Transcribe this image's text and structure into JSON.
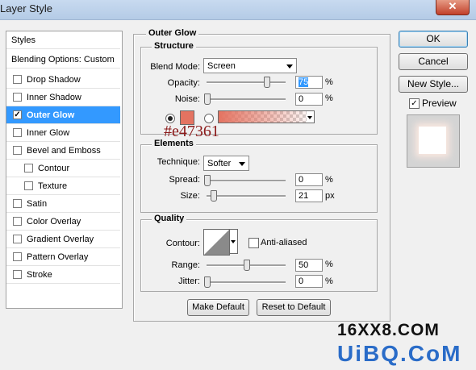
{
  "window": {
    "title": "Layer Style",
    "close_glyph": "✕"
  },
  "styles_list": {
    "header": "Styles",
    "blending": "Blending Options: Custom",
    "items": [
      {
        "label": "Drop Shadow",
        "checked": ""
      },
      {
        "label": "Inner Shadow",
        "checked": ""
      },
      {
        "label": "Outer Glow",
        "checked": "✓"
      },
      {
        "label": "Inner Glow",
        "checked": ""
      },
      {
        "label": "Bevel and Emboss",
        "checked": ""
      },
      {
        "label": "Contour",
        "checked": ""
      },
      {
        "label": "Texture",
        "checked": ""
      },
      {
        "label": "Satin",
        "checked": ""
      },
      {
        "label": "Color Overlay",
        "checked": ""
      },
      {
        "label": "Gradient Overlay",
        "checked": ""
      },
      {
        "label": "Pattern Overlay",
        "checked": ""
      },
      {
        "label": "Stroke",
        "checked": ""
      }
    ]
  },
  "outer_glow": {
    "title": "Outer Glow",
    "structure": {
      "title": "Structure",
      "blend_mode_label": "Blend Mode:",
      "blend_mode": "Screen",
      "opacity_label": "Opacity:",
      "opacity": "75",
      "opacity_unit": "%",
      "noise_label": "Noise:",
      "noise": "0",
      "noise_unit": "%",
      "glow_color": "#e47361",
      "color_note": "#e47361"
    },
    "elements": {
      "title": "Elements",
      "technique_label": "Technique:",
      "technique": "Softer",
      "spread_label": "Spread:",
      "spread": "0",
      "spread_unit": "%",
      "size_label": "Size:",
      "size": "21",
      "size_unit": "px"
    },
    "quality": {
      "title": "Quality",
      "contour_label": "Contour:",
      "anti_aliased_label": "Anti-aliased",
      "anti_aliased": "",
      "range_label": "Range:",
      "range": "50",
      "range_unit": "%",
      "jitter_label": "Jitter:",
      "jitter": "0",
      "jitter_unit": "%"
    },
    "make_default": "Make Default",
    "reset_default": "Reset to Default"
  },
  "buttons": {
    "ok": "OK",
    "cancel": "Cancel",
    "new_style": "New Style...",
    "preview_label": "Preview",
    "preview_checked": "✓"
  },
  "watermark": {
    "line1": "16XX8.COM",
    "line2": "UiBQ.CoM"
  },
  "colors": {
    "selection": "#3399ff",
    "glow": "#e47361"
  }
}
